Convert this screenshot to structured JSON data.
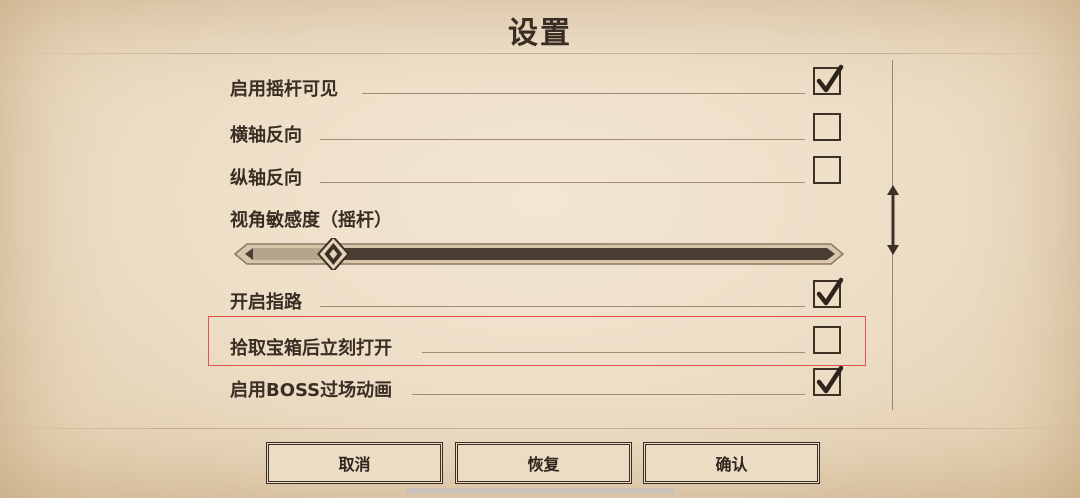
{
  "title": "设置",
  "settings": [
    {
      "label": "启用摇杆可见",
      "checked": true
    },
    {
      "label": "横轴反向",
      "checked": false
    },
    {
      "label": "纵轴反向",
      "checked": false
    }
  ],
  "slider": {
    "label": "视角敏感度（摇杆）",
    "value": 0.14
  },
  "settings2": [
    {
      "label": "开启指路",
      "checked": true
    },
    {
      "label": "拾取宝箱后立刻打开",
      "checked": false
    },
    {
      "label": "启用BOSS过场动画",
      "checked": true
    }
  ],
  "buttons": {
    "cancel": "取消",
    "restore": "恢复",
    "confirm": "确认"
  },
  "colors": {
    "paper": "#ecdcc4",
    "ink": "#3a2e24",
    "highlight": "#e0554a"
  }
}
